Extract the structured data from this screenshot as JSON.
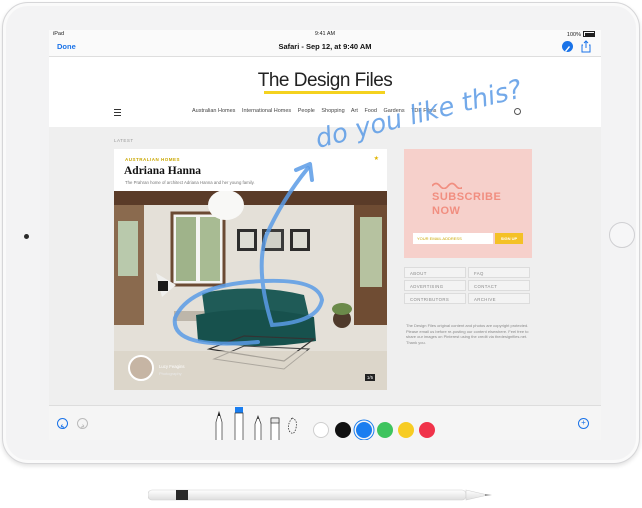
{
  "statusbar": {
    "carrier": "iPad",
    "time": "9:41 AM",
    "battery": "100%"
  },
  "navbar": {
    "done_label": "Done",
    "title": "Safari - Sep 12, at 9:40 AM"
  },
  "website": {
    "logo": "The Design Files",
    "nav_links": [
      "Australian Homes",
      "International Homes",
      "People",
      "Shopping",
      "Art",
      "Food",
      "Gardens",
      "TDF Films"
    ],
    "section_label": "LATEST",
    "featured": {
      "category": "AUSTRALIAN HOMES",
      "title": "Adriana Hanna",
      "subtitle": "The Prahran home of architect Adriana Hanna and her young family.",
      "photo_caption": "Lucy Feagins",
      "photo_caption_sub": "Photography",
      "photo_count": "1/5"
    },
    "ad": {
      "line1": "SUBSCRIBE",
      "line2": "NOW",
      "email_placeholder": "YOUR EMAIL ADDRESS",
      "signup_label": "SIGN UP",
      "accent": "#f18e80"
    },
    "links": [
      "ABOUT",
      "FAQ",
      "ADVERTISING",
      "CONTACT",
      "CONTRIBUTORS",
      "ARCHIVE"
    ],
    "footer": "The Design Files original content and photos are copyright protected. Please email us before re-posting our content elsewhere. Feel free to share our images on Pinterest using the credit via thedesignfiles.net. Thank you."
  },
  "annotation": {
    "text": "do you like this?",
    "color": "#5b9be6"
  },
  "markup_toolbar": {
    "tools": [
      "pen-icon",
      "marker-icon",
      "pencil-icon",
      "eraser-icon",
      "lasso-icon"
    ],
    "colors": [
      "#ffffff",
      "#111111",
      "#1a7ef0",
      "#3ec45e",
      "#f7cc23",
      "#f0334a"
    ],
    "selected_color_index": 2
  }
}
